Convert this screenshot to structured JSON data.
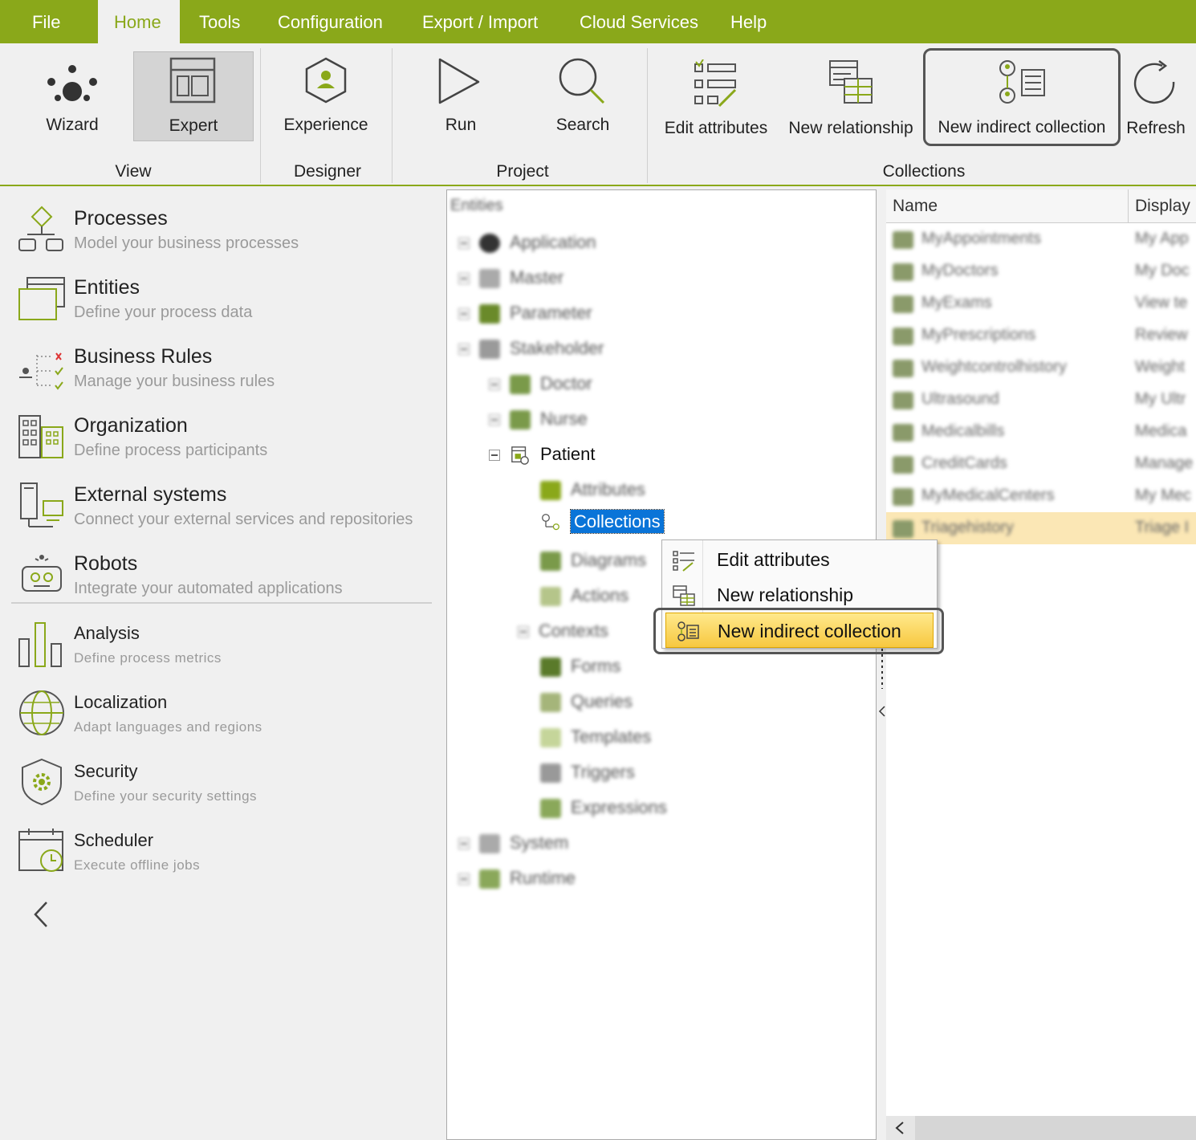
{
  "menubar": {
    "items": [
      "File",
      "Home",
      "Tools",
      "Configuration",
      "Export / Import",
      "Cloud Services",
      "Help"
    ],
    "active": "Home"
  },
  "ribbon": {
    "buttons": {
      "wizard": "Wizard",
      "expert": "Expert",
      "experience": "Experience",
      "run": "Run",
      "search": "Search",
      "edit_attributes": "Edit attributes",
      "new_relationship": "New relationship",
      "new_indirect_collection": "New indirect collection",
      "refresh": "Refresh"
    },
    "groups": {
      "view": "View",
      "designer": "Designer",
      "project": "Project",
      "collections": "Collections"
    }
  },
  "leftnav": {
    "items": [
      {
        "title": "Processes",
        "desc": "Model your business processes"
      },
      {
        "title": "Entities",
        "desc": "Define your process data"
      },
      {
        "title": "Business Rules",
        "desc": "Manage your business rules"
      },
      {
        "title": "Organization",
        "desc": "Define process participants"
      },
      {
        "title": "External systems",
        "desc": "Connect your external services and repositories"
      },
      {
        "title": "Robots",
        "desc": "Integrate your automated applications"
      },
      {
        "title": "Analysis",
        "desc": "Define process metrics"
      },
      {
        "title": "Localization",
        "desc": "Adapt languages and regions"
      },
      {
        "title": "Security",
        "desc": "Define your security settings"
      },
      {
        "title": "Scheduler",
        "desc": "Execute offline jobs"
      }
    ],
    "collapse_icon": "chevron-left-icon"
  },
  "tree": {
    "root": "Entities",
    "nodes": {
      "application": "Application",
      "master": "Master",
      "parameter": "Parameter",
      "stakeholder": "Stakeholder",
      "doctor": "Doctor",
      "nurse": "Nurse",
      "patient": "Patient",
      "attributes": "Attributes",
      "collections": "Collections",
      "diagrams": "Diagrams",
      "actions": "Actions",
      "contexts": "Contexts",
      "forms": "Forms",
      "queries": "Queries",
      "templates": "Templates",
      "triggers": "Triggers",
      "expressions": "Expressions",
      "system": "System",
      "runtime": "Runtime"
    },
    "selected": "Collections"
  },
  "list": {
    "columns": [
      "Name",
      "Display"
    ],
    "rows": [
      {
        "name": "MyAppointments",
        "display": "My App"
      },
      {
        "name": "MyDoctors",
        "display": "My Doc"
      },
      {
        "name": "MyExams",
        "display": "View te"
      },
      {
        "name": "MyPrescriptions",
        "display": "Review"
      },
      {
        "name": "Weightcontrolhistory",
        "display": "Weight"
      },
      {
        "name": "Ultrasound",
        "display": "My Ultr"
      },
      {
        "name": "Medicalbills",
        "display": "Medica"
      },
      {
        "name": "CreditCards",
        "display": "Manage"
      },
      {
        "name": "MyMedicalCenters",
        "display": "My Mec"
      },
      {
        "name": "Triagehistory",
        "display": "Triage I"
      }
    ]
  },
  "context_menu": {
    "items": [
      "Edit attributes",
      "New relationship",
      "New indirect collection"
    ],
    "highlighted": "New indirect collection"
  },
  "colors": {
    "accent": "#8aa81a",
    "selection": "#0a74d8",
    "highlight": "#f7c840"
  }
}
